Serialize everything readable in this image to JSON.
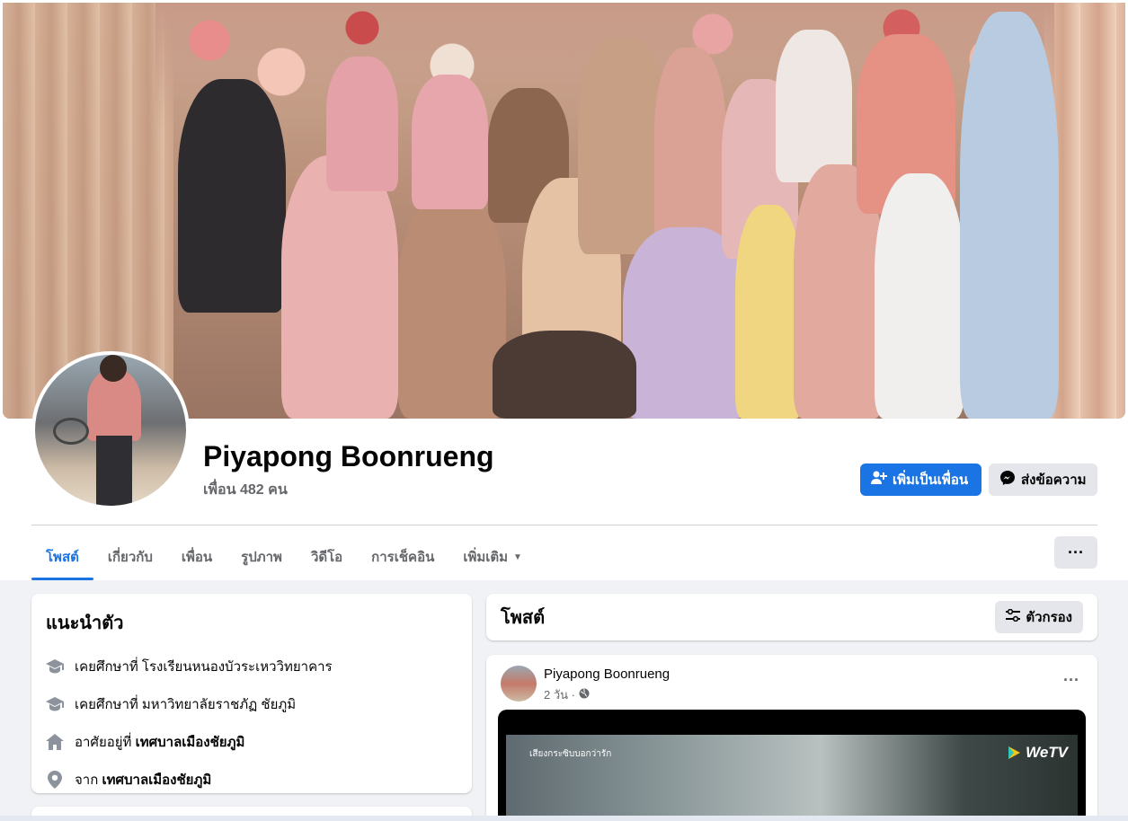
{
  "profile": {
    "name": "Piyapong Boonrueng",
    "friends_text": "เพื่อน 482 คน"
  },
  "actions": {
    "add_friend": "เพิ่มเป็นเพื่อน",
    "message": "ส่งข้อความ"
  },
  "tabs": [
    {
      "label": "โพสต์",
      "active": true
    },
    {
      "label": "เกี่ยวกับ"
    },
    {
      "label": "เพื่อน"
    },
    {
      "label": "รูปภาพ"
    },
    {
      "label": "วิดีโอ"
    },
    {
      "label": "การเช็คอิน"
    },
    {
      "label": "เพิ่มเติม"
    }
  ],
  "more_button": "···",
  "intro": {
    "title": "แนะนำตัว",
    "items": [
      {
        "icon": "graduation-cap-icon",
        "prefix": "เคยศึกษาที่ โรงเรียนหนองบัวระเหววิทยาคาร",
        "bold": ""
      },
      {
        "icon": "graduation-cap-icon",
        "prefix": "เคยศึกษาที่ มหาวิทยาลัยราชภัฏ ชัยภูมิ",
        "bold": ""
      },
      {
        "icon": "home-icon",
        "prefix": "อาศัยอยู่ที่ ",
        "bold": "เทศบาลเมืองชัยภูมิ"
      },
      {
        "icon": "location-pin-icon",
        "prefix": "จาก ",
        "bold": "เทศบาลเมืองชัยภูมิ"
      }
    ]
  },
  "posts": {
    "title": "โพสต์",
    "filter_label": "ตัวกรอง",
    "post": {
      "author": "Piyapong Boonrueng",
      "time": "2 วัน ·",
      "privacy_icon": "globe-icon",
      "video_caption": "เสียงกระซิบบอกว่ารัก",
      "video_brand": "WeTV"
    }
  },
  "colors": {
    "accent": "#1b74e4",
    "secondary_btn": "#e4e6eb",
    "muted_text": "#65676b",
    "background": "#f0f2f5"
  }
}
